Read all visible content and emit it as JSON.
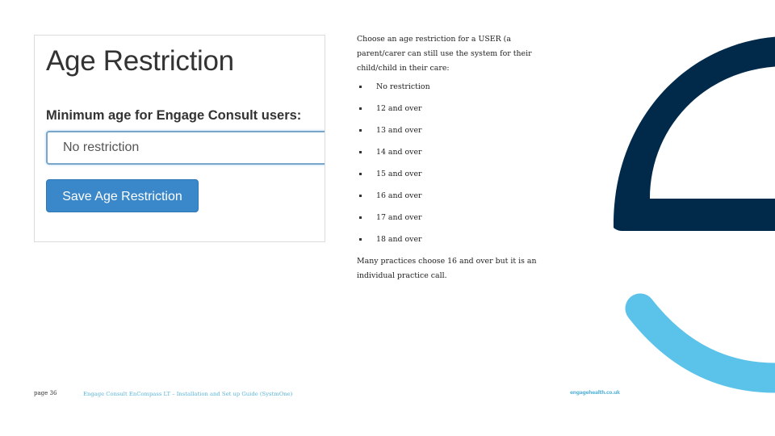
{
  "screenshot_card": {
    "title": "Age Restriction",
    "field_label": "Minimum age for Engage Consult users:",
    "select_value": "No restriction",
    "save_button_label": "Save Age Restriction"
  },
  "instructions": {
    "intro": "Choose an age restriction for a USER (a parent/carer can still use the system for their child/child in their care:",
    "options": [
      "No restriction",
      "12 and over",
      "13 and over",
      "14 and over",
      "15 and over",
      "16 and over",
      "17 and over",
      "18 and over"
    ],
    "outro": "Many practices choose 16 and over but it is an individual practice call."
  },
  "footer": {
    "page_number": "page 36",
    "document_title": "Engage Consult EnCompass LT – Installation and Set up Guide (SystmOne)",
    "website": "engagehealth.co.uk"
  },
  "brand_colors": {
    "navy": "#012a4a",
    "light_blue": "#5bc2ea",
    "button_blue": "#3a87c9"
  }
}
